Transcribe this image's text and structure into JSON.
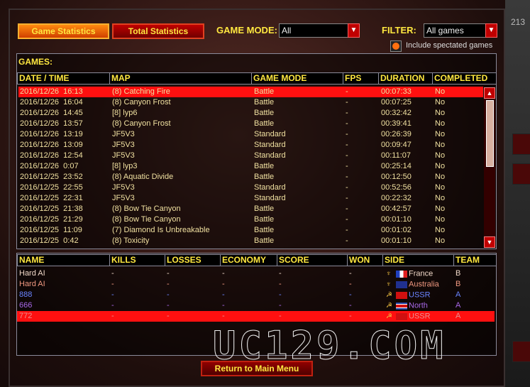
{
  "tabs": [
    {
      "label": "Game Statistics",
      "active": true
    },
    {
      "label": "Total Statistics",
      "active": false
    }
  ],
  "game_mode": {
    "label": "GAME MODE:",
    "value": "All"
  },
  "filter": {
    "label": "FILTER:",
    "value": "All games"
  },
  "include_spectated": {
    "label": "Include spectated games",
    "checked": true
  },
  "games": {
    "title": "GAMES:",
    "columns": [
      "DATE / TIME",
      "MAP",
      "GAME MODE",
      "FPS",
      "DURATION",
      "COMPLETED"
    ],
    "rows": [
      [
        "2016/12/26  16:13",
        "(8) Catching Fire",
        "Battle",
        "-",
        "00:07:33",
        "No"
      ],
      [
        "2016/12/26  16:04",
        "(8) Canyon Frost",
        "Battle",
        "-",
        "00:07:25",
        "No"
      ],
      [
        "2016/12/26  14:45",
        "[8] lyp6",
        "Battle",
        "-",
        "00:32:42",
        "No"
      ],
      [
        "2016/12/26  13:57",
        "(8) Canyon Frost",
        "Battle",
        "-",
        "00:39:41",
        "No"
      ],
      [
        "2016/12/26  13:19",
        "JF5V3",
        "Standard",
        "-",
        "00:26:39",
        "No"
      ],
      [
        "2016/12/26  13:09",
        "JF5V3",
        "Standard",
        "-",
        "00:09:47",
        "No"
      ],
      [
        "2016/12/26  12:54",
        "JF5V3",
        "Standard",
        "-",
        "00:11:07",
        "No"
      ],
      [
        "2016/12/26  0:07",
        "[8] lyp3",
        "Battle",
        "-",
        "00:25:14",
        "No"
      ],
      [
        "2016/12/25  23:52",
        "(8) Aquatic Divide",
        "Battle",
        "-",
        "00:12:50",
        "No"
      ],
      [
        "2016/12/25  22:55",
        "JF5V3",
        "Standard",
        "-",
        "00:52:56",
        "No"
      ],
      [
        "2016/12/25  22:31",
        "JF5V3",
        "Standard",
        "-",
        "00:22:32",
        "No"
      ],
      [
        "2016/12/25  21:38",
        "(8) Bow Tie Canyon",
        "Battle",
        "-",
        "00:42:57",
        "No"
      ],
      [
        "2016/12/25  21:29",
        "(8) Bow Tie Canyon",
        "Battle",
        "-",
        "00:01:10",
        "No"
      ],
      [
        "2016/12/25  11:09",
        "(7) Diamond Is Unbreakable",
        "Battle",
        "-",
        "00:01:02",
        "No"
      ],
      [
        "2016/12/25  0:42",
        "(8) Toxicity",
        "Battle",
        "-",
        "00:01:10",
        "No"
      ]
    ]
  },
  "players": {
    "columns": [
      "NAME",
      "KILLS",
      "LOSSES",
      "ECONOMY",
      "SCORE",
      "WON",
      "SIDE",
      "TEAM"
    ],
    "rows": [
      {
        "cells": [
          "Hard AI",
          "-",
          "-",
          "-",
          "-",
          "-",
          "France",
          "B"
        ],
        "color": "#f0d8c8",
        "faction": "allied"
      },
      {
        "cells": [
          "Hard AI",
          "-",
          "-",
          "-",
          "-",
          "-",
          "Australia",
          "B"
        ],
        "color": "#f09880",
        "faction": "allied"
      },
      {
        "cells": [
          "888",
          "-",
          "-",
          "-",
          "-",
          "-",
          "USSR",
          "A"
        ],
        "color": "#6a84ff",
        "faction": "soviet"
      },
      {
        "cells": [
          "666",
          "-",
          "-",
          "-",
          "-",
          "-",
          "North",
          "A"
        ],
        "color": "#a868e8",
        "faction": "soviet"
      },
      {
        "cells": [
          "772",
          "-",
          "-",
          "-",
          "-",
          "-",
          "USSR",
          "A"
        ],
        "color": "#e89090",
        "faction": "soviet"
      }
    ]
  },
  "return_button": "Return to Main Menu",
  "side_counter": "213",
  "watermark": "UC129.COM"
}
